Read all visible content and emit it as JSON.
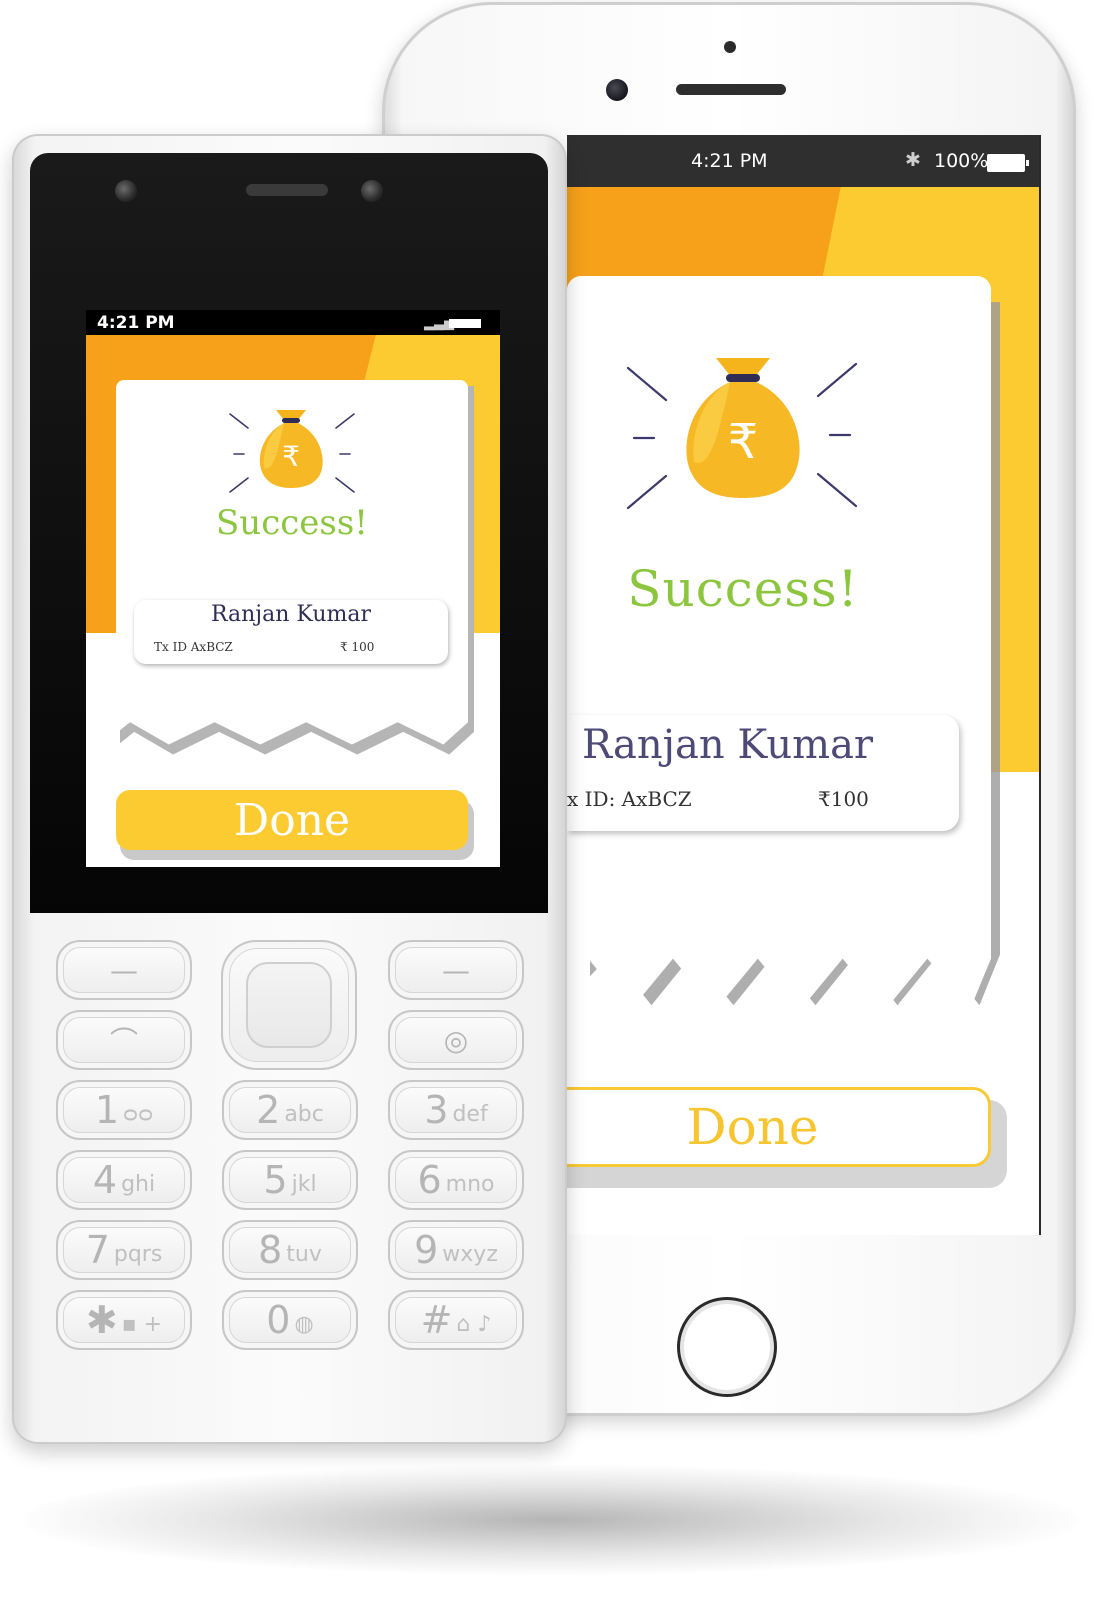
{
  "smartphone": {
    "status_bar": {
      "time": "4:21 PM",
      "battery_percent": "100%"
    },
    "success_title": "Success!",
    "payee_name": "Ranjan Kumar",
    "transaction_id": "x ID: AxBCZ",
    "amount": "₹100",
    "done_label": "Done"
  },
  "feature_phone": {
    "status_bar": {
      "time": "4:21 PM"
    },
    "success_title": "Success!",
    "payee_name": "Ranjan Kumar",
    "transaction_id": "Tx ID AxBCZ",
    "amount": "₹ 100",
    "done_label": "Done",
    "keypad": [
      {
        "digit": "1",
        "letters": "ᴑᴑ"
      },
      {
        "digit": "2",
        "letters": "abc"
      },
      {
        "digit": "3",
        "letters": "def"
      },
      {
        "digit": "4",
        "letters": "ghi"
      },
      {
        "digit": "5",
        "letters": "jkl"
      },
      {
        "digit": "6",
        "letters": "mno"
      },
      {
        "digit": "7",
        "letters": "pqrs"
      },
      {
        "digit": "8",
        "letters": "tuv"
      },
      {
        "digit": "9",
        "letters": "wxyz"
      },
      {
        "digit": "✱",
        "letters": "▪ +"
      },
      {
        "digit": "0",
        "letters": "◍"
      },
      {
        "digit": "#",
        "letters": "⌂ ♪"
      }
    ]
  },
  "colors": {
    "orange": "#f7a11a",
    "yellow": "#fccb32",
    "success_green": "#8cc63f",
    "payee_purple": "#4e4a77",
    "done_yellow": "#f7c530"
  },
  "icons": [
    "money-bag-icon",
    "bluetooth-icon",
    "battery-icon",
    "signal-icon"
  ]
}
